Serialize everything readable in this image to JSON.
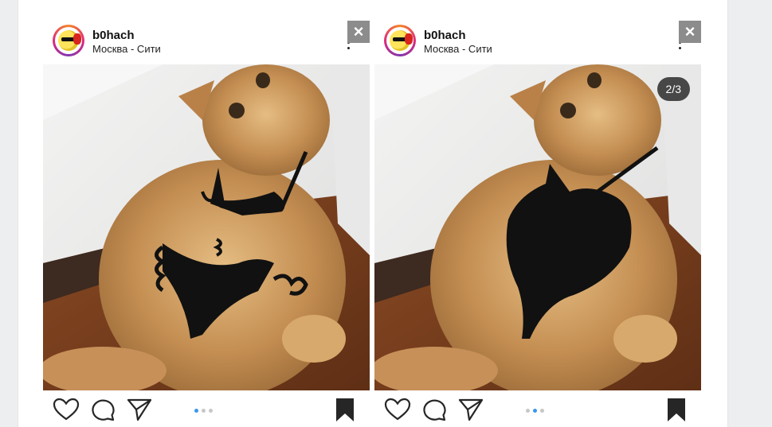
{
  "posts": [
    {
      "username": "b0hach",
      "location": "Москва - Сити",
      "counter": "",
      "active_dot": 0,
      "close_label": "×"
    },
    {
      "username": "b0hach",
      "location": "Москва - Сити",
      "counter": "2/3",
      "active_dot": 1,
      "close_label": "×"
    }
  ],
  "colors": {
    "accent": "#3897f0",
    "dot_inactive": "#c7c7c7",
    "close_bg": "#8c8c8c"
  },
  "icons": [
    "heart-icon",
    "comment-icon",
    "share-icon",
    "bookmark-icon",
    "close-icon",
    "more-icon"
  ]
}
